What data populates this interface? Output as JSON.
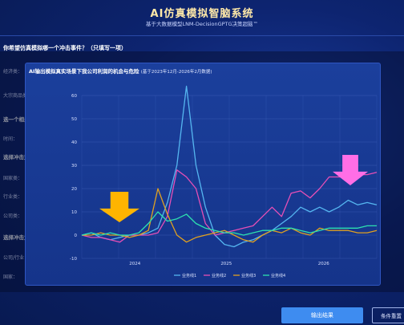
{
  "app": {
    "title": "AI仿真模拟智脑系统",
    "subtitle": "基于大数据模型LNM-DecisionGPTG决策超脑™"
  },
  "form": {
    "question": "你希望仿真模拟哪一个冲击事件？（只填写一项）",
    "labels": [
      "经济类：",
      "大宗商品类",
      "选一个相关",
      "时间：",
      "选择冲击对",
      "国家类：",
      "行业类：",
      "公司类：",
      "选择冲击力",
      "公司/行业：",
      "国家："
    ]
  },
  "buttons": {
    "primary": "输出结果",
    "secondary": "条件重置"
  },
  "panel": {
    "title": "AI输出模拟真实场景下我公司利润的机会与危险",
    "title_note": "(基于2023年12月-2026年2月数据)"
  },
  "colors": {
    "series1": "#55b6f0",
    "series2": "#e64fb6",
    "series3": "#e0a020",
    "series4": "#2de0b0",
    "arrow_left": "#ffb400",
    "arrow_right": "#ff6ee6"
  },
  "chart_data": {
    "type": "line",
    "x_ticks": [
      "2024",
      "2025",
      "2026"
    ],
    "y_ticks": [
      -10,
      0,
      10,
      20,
      30,
      40,
      50,
      60
    ],
    "ylim": [
      -10,
      60
    ],
    "grid": true,
    "legend_position": "bottom",
    "series": [
      {
        "name": "业务线1",
        "color": "#55b6f0",
        "values": [
          0,
          1,
          -1,
          -2,
          -1,
          0,
          0,
          1,
          3,
          14,
          30,
          64,
          30,
          12,
          0,
          -4,
          -5,
          -3,
          -2,
          0,
          2,
          5,
          8,
          12,
          10,
          12,
          10,
          12,
          15,
          13,
          14,
          13
        ]
      },
      {
        "name": "业务线2",
        "color": "#e64fb6",
        "values": [
          0,
          -1,
          -1,
          -2,
          -3,
          0,
          0,
          0,
          1,
          8,
          28,
          25,
          20,
          5,
          0,
          1,
          2,
          3,
          4,
          8,
          12,
          8,
          18,
          19,
          16,
          20,
          25,
          25,
          25,
          26,
          26,
          27
        ]
      },
      {
        "name": "业务线3",
        "color": "#e0a020",
        "values": [
          0,
          0,
          1,
          0,
          0,
          -1,
          0,
          2,
          20,
          9,
          0,
          -3,
          -1,
          0,
          1,
          2,
          0,
          -2,
          -3,
          0,
          2,
          1,
          3,
          1,
          0,
          3,
          2,
          2,
          2,
          1,
          1,
          2
        ]
      },
      {
        "name": "业务线4",
        "color": "#2de0b0",
        "values": [
          0,
          1,
          0,
          1,
          0,
          0,
          1,
          5,
          10,
          6,
          7,
          9,
          5,
          3,
          2,
          1,
          1,
          0,
          1,
          2,
          2,
          3,
          3,
          2,
          1,
          2,
          3,
          3,
          3,
          3,
          4,
          4
        ]
      }
    ]
  }
}
